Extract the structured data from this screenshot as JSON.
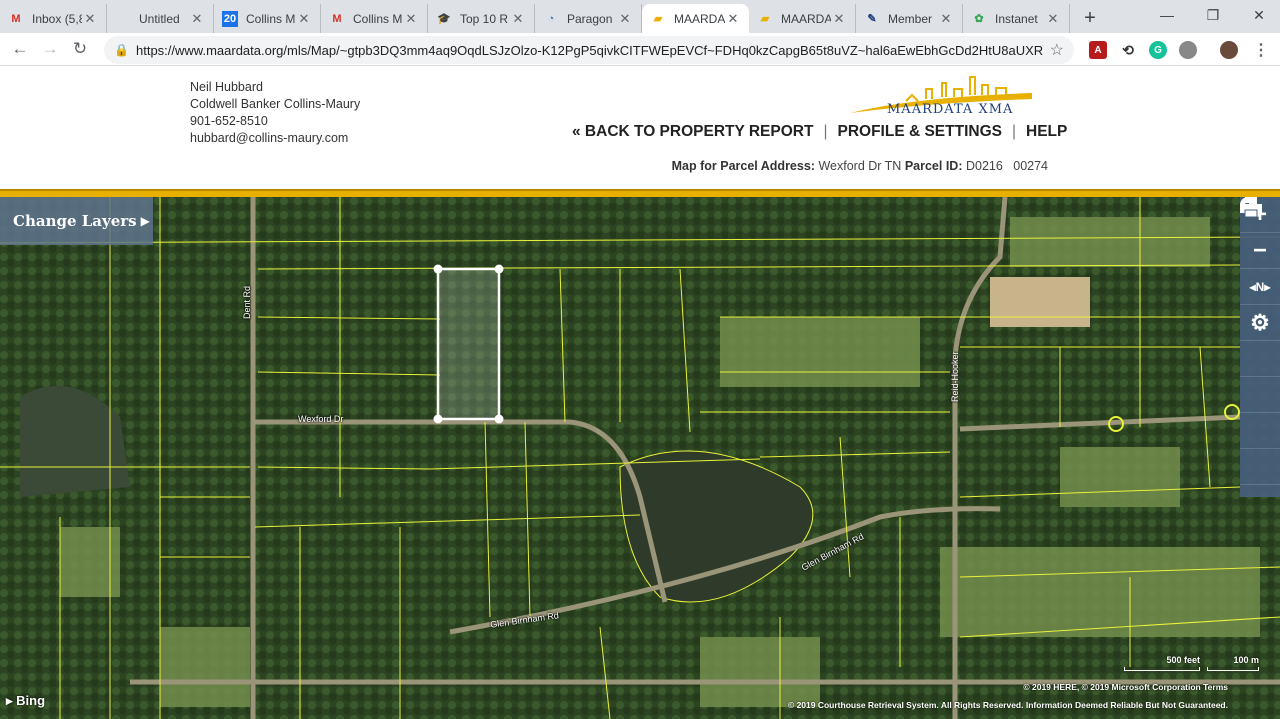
{
  "browser": {
    "tabs": [
      {
        "label": "Inbox (5,8",
        "icon": "gmail-icon",
        "active": false
      },
      {
        "label": "Untitled",
        "icon": "blank-page-icon",
        "active": false
      },
      {
        "label": "Collins M",
        "icon": "calendar-icon",
        "active": false
      },
      {
        "label": "Collins M",
        "icon": "gmail-icon",
        "active": false
      },
      {
        "label": "Top 10 R",
        "icon": "graduation-cap-icon",
        "active": false
      },
      {
        "label": "Paragon",
        "icon": "paragon-icon",
        "active": false
      },
      {
        "label": "MAARDA",
        "icon": "maardata-icon",
        "active": true
      },
      {
        "label": "MAARDA",
        "icon": "maardata-icon",
        "active": false
      },
      {
        "label": "Member",
        "icon": "member-icon",
        "active": false
      },
      {
        "label": "Instanet",
        "icon": "instanet-icon",
        "active": false
      }
    ],
    "calendar_badge": "20",
    "gmail_letter": "M",
    "newtab_label": "+",
    "url": "https://www.maardata.org/mls/Map/~gtpb3DQ3mm4aq9OqdLSJzOlzo-K12PgP5qivkCITFWEpEVCf~FDHq0kzCapgB65t8uVZ~hal6aEwEbhGcDd2HtU8aUXRI..."
  },
  "agent": {
    "name": "Neil Hubbard",
    "company": "Coldwell Banker Collins-Maury",
    "phone": "901-652-8510",
    "email": "hubbard@collins-maury.com"
  },
  "logo_text": "MAARDATA XMA",
  "nav": {
    "back": "« BACK TO PROPERTY REPORT",
    "profile": "PROFILE & SETTINGS",
    "help": "HELP",
    "separator": "|"
  },
  "parcel": {
    "label": "Map for Parcel Address:",
    "address": "Wexford Dr TN",
    "id_label": "Parcel ID:",
    "id": "D0216   00274"
  },
  "map": {
    "change_layers": "Change Layers",
    "tools": [
      {
        "name": "zoom-in-button",
        "glyph": "+"
      },
      {
        "name": "zoom-out-button",
        "glyph": "-"
      },
      {
        "name": "compass-button",
        "glyph": "N"
      },
      {
        "name": "settings-button",
        "glyph": "⚙"
      },
      {
        "name": "location-button",
        "glyph": "⬤"
      },
      {
        "name": "search-button",
        "glyph": "⌕"
      },
      {
        "name": "measure-button",
        "glyph": "▭"
      },
      {
        "name": "print-button",
        "glyph": "▤"
      }
    ],
    "roads": {
      "dent": "Dent Rd",
      "wexford": "Wexford Dr",
      "glen1": "Glen Birnham Rd",
      "glen2": "Glen Birnham Rd",
      "reid": "Reid-Hooker"
    },
    "bing": "Bing",
    "scale_feet": "500 feet",
    "scale_m": "100 m",
    "attribution_1": "© 2019 HERE, © 2019 Microsoft Corporation  Terms",
    "attribution_2": "© 2019 Courthouse Retrieval System. All Rights Reserved. Information Deemed Reliable But Not Guaranteed."
  },
  "colors": {
    "parcel_lines": "#e9f23a",
    "selected_parcel": "#ffffff",
    "gold_bar": "#e8b000",
    "panel": "#465f7d"
  }
}
